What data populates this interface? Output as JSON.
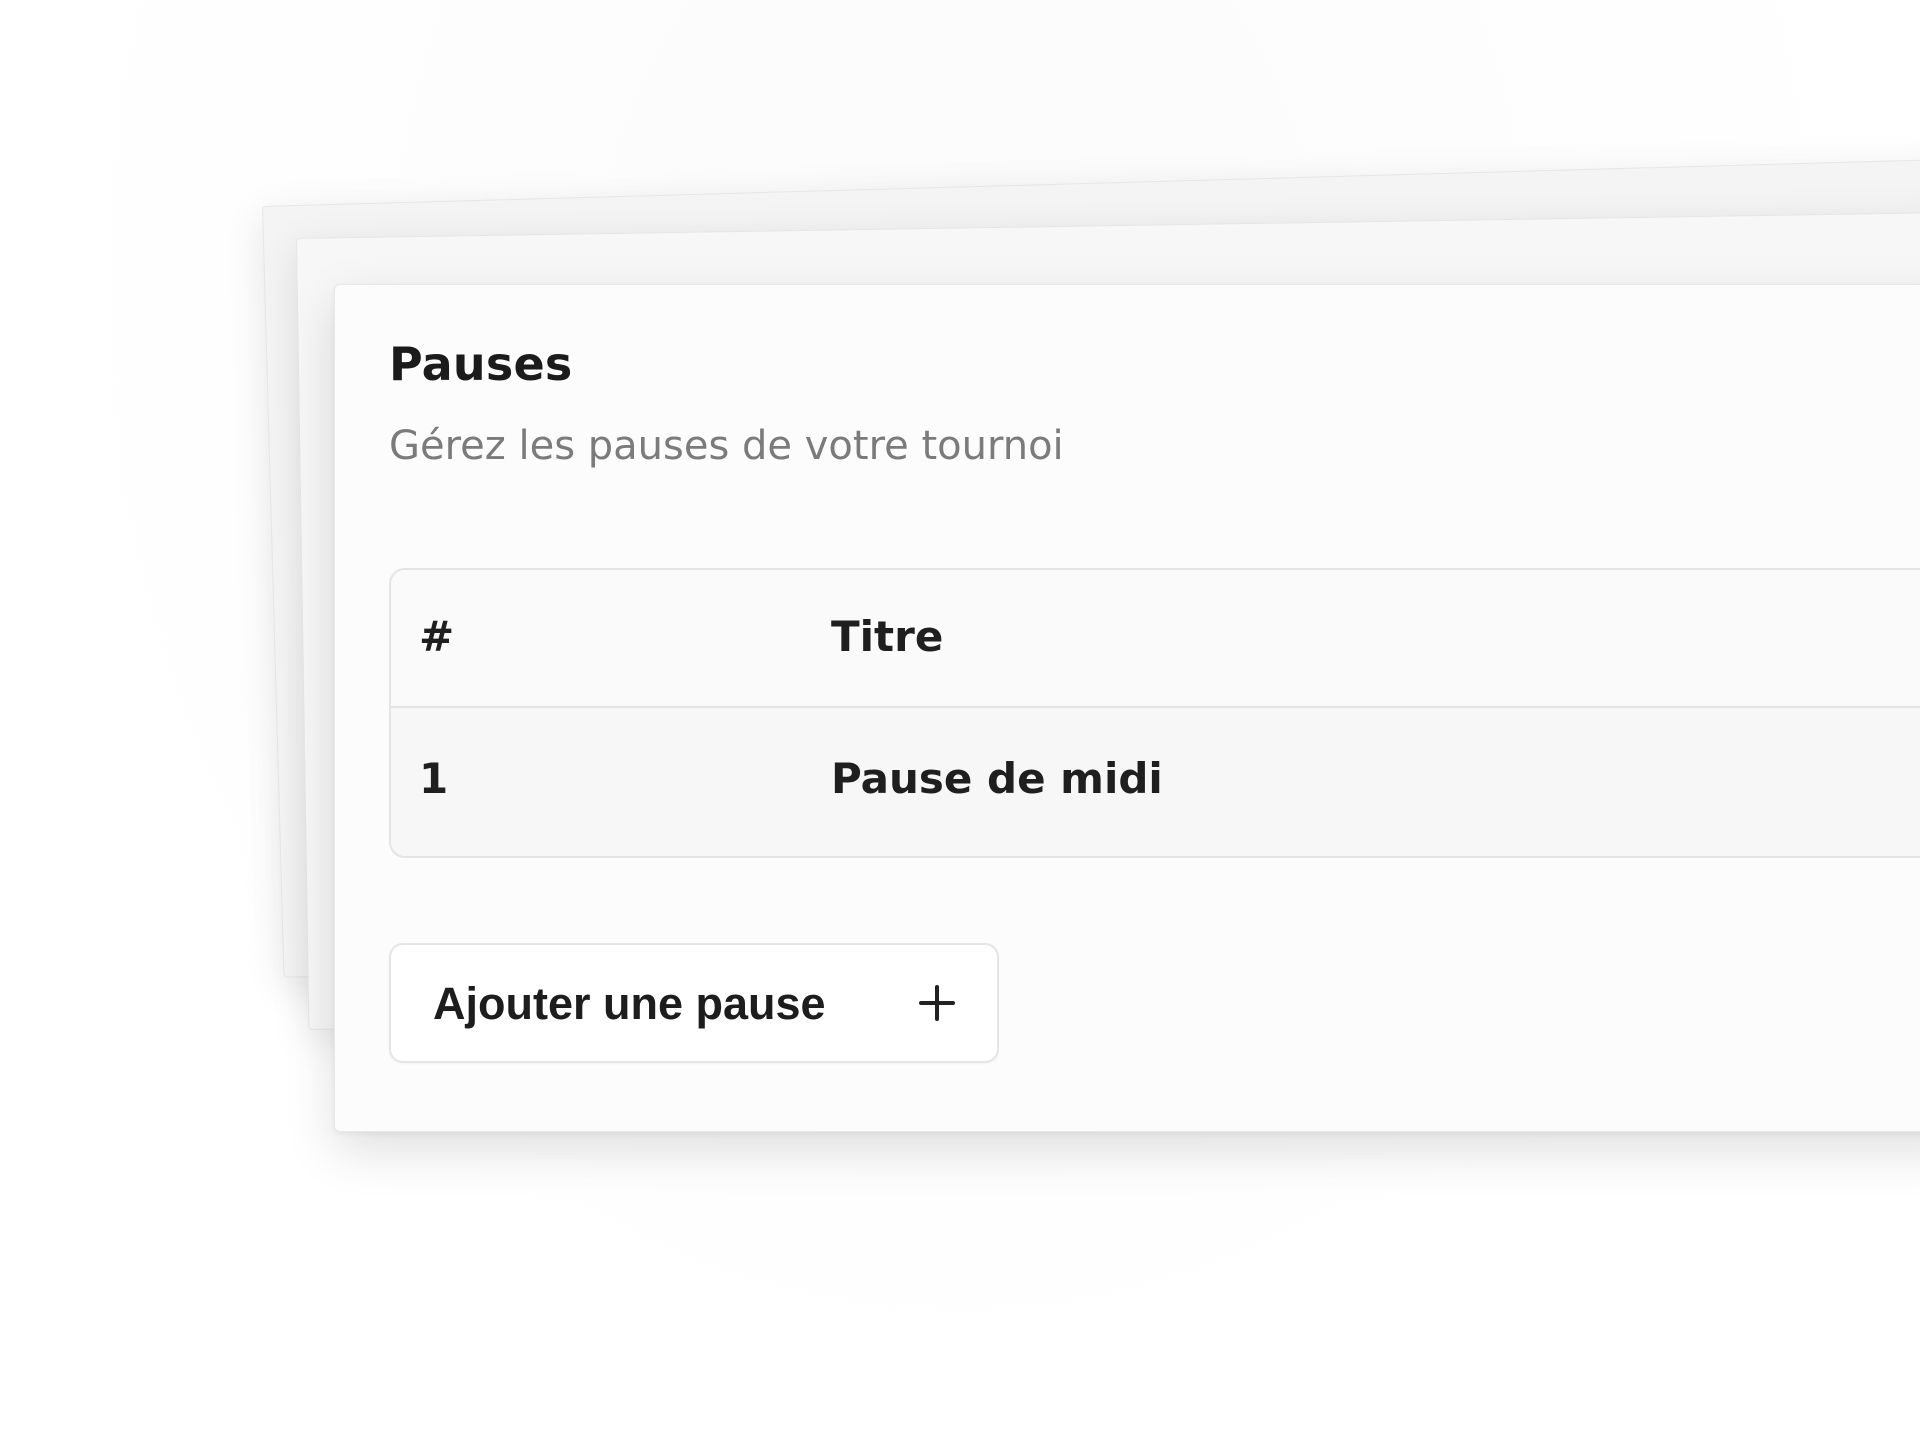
{
  "panel": {
    "title": "Pauses",
    "subtitle": "Gérez les pauses de votre tournoi"
  },
  "table": {
    "columns": [
      "#",
      "Titre"
    ],
    "rows": [
      {
        "number": "1",
        "title": "Pause de midi"
      }
    ]
  },
  "actions": {
    "add_pause_label": "Ajouter une pause",
    "add_pause_icon": "plus-icon"
  },
  "colors": {
    "background": "#ffffff",
    "card_background": "#fcfcfc",
    "border": "#e4e4e4",
    "subtitle_text": "#7b7b7b",
    "primary_text": "#1f1f1f"
  }
}
